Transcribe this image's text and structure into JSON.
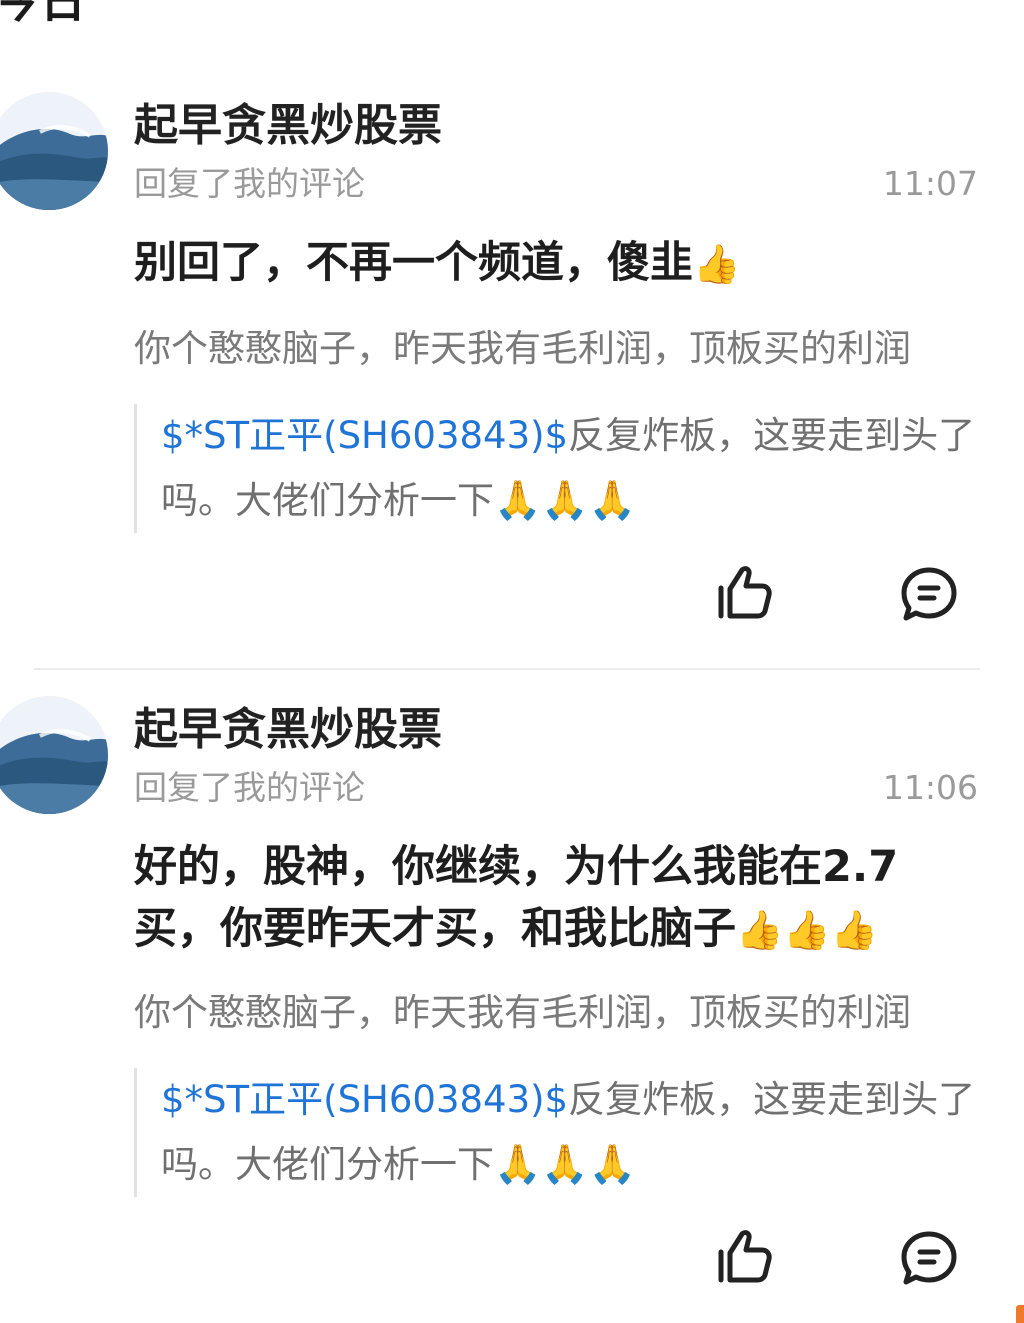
{
  "section": {
    "title": "今日"
  },
  "items": [
    {
      "name": "起早贪黑炒股票",
      "subtitle": "回复了我的评论",
      "time": "11:07",
      "reply_text": "别回了，不再一个频道，傻韭",
      "reply_emoji": "👍",
      "my_comment": "你个憨憨脑子，昨天我有毛利润，顶板买的利润",
      "quote_stock": "$*ST正平(SH603843)$",
      "quote_text": "反复炸板，这要走到头了吗。大佬们分析一下",
      "quote_emoji": "🙏🙏🙏"
    },
    {
      "name": "起早贪黑炒股票",
      "subtitle": "回复了我的评论",
      "time": "11:06",
      "reply_text": "好的，股神，你继续，为什么我能在2.7买，你要昨天才买，和我比脑子",
      "reply_emoji": "👍👍👍",
      "my_comment": "你个憨憨脑子，昨天我有毛利润，顶板买的利润",
      "quote_stock": "$*ST正平(SH603843)$",
      "quote_text": "反复炸板，这要走到头了吗。大佬们分析一下",
      "quote_emoji": "🙏🙏🙏"
    }
  ]
}
